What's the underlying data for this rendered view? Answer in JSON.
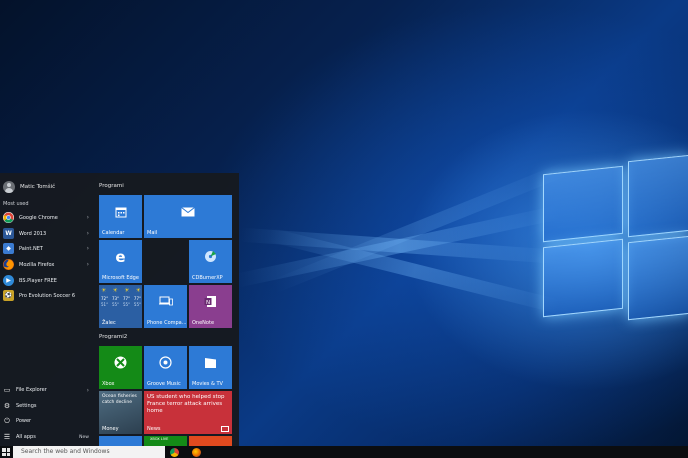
{
  "start_menu": {
    "user": {
      "name": "Matic Tomšič"
    },
    "most_used_label": "Most used",
    "apps": [
      {
        "label": "Google Chrome",
        "icon": "chrome-icon",
        "color": "#dfe3e8",
        "has_submenu": true
      },
      {
        "label": "Word 2013",
        "icon": "word-icon",
        "color": "#2b5797",
        "has_submenu": true
      },
      {
        "label": "Paint.NET",
        "icon": "paintnet-icon",
        "color": "#3b7bd1",
        "has_submenu": true
      },
      {
        "label": "Mozilla Firefox",
        "icon": "firefox-icon",
        "color": "#e66000",
        "has_submenu": true
      },
      {
        "label": "BS.Player FREE",
        "icon": "bsplayer-icon",
        "color": "#2f8ad8",
        "has_submenu": false
      },
      {
        "label": "Pro Evolution Soccer 6",
        "icon": "pes-icon",
        "color": "#4a6b8a",
        "has_submenu": false
      }
    ],
    "bottom": {
      "file_explorer": "File Explorer",
      "settings": "Settings",
      "power": "Power",
      "all_apps": "All apps",
      "new_badge": "New"
    },
    "groups": {
      "group1": "Programi",
      "group2": "Programi2"
    },
    "tiles": {
      "calendar": "Calendar",
      "mail": "Mail",
      "edge": "Microsoft Edge",
      "cdburner": "CDBurnerXP",
      "weather_place": "Žalec",
      "weather_temps": [
        "72°",
        "73°",
        "77°",
        "77°"
      ],
      "weather_lows": [
        "51°",
        "55°",
        "55°",
        "55°"
      ],
      "phone": "Phone Compa...",
      "onenote": "OneNote",
      "xbox": "Xbox",
      "groove": "Groove Music",
      "movies": "Movies & TV",
      "money": "Money",
      "money_headline": "Ocean fisheries catch decline",
      "news": "News",
      "news_headline": "US student who helped stop France terror attack arrives home",
      "xbox_live": "XBOX LIVE"
    }
  },
  "taskbar": {
    "search_placeholder": "Search the web and Windows"
  },
  "colors": {
    "tile_blue": "#2d7ad6",
    "tile_purple": "#8a3e8f",
    "tile_green": "#148a17",
    "tile_red": "#c8313a"
  }
}
